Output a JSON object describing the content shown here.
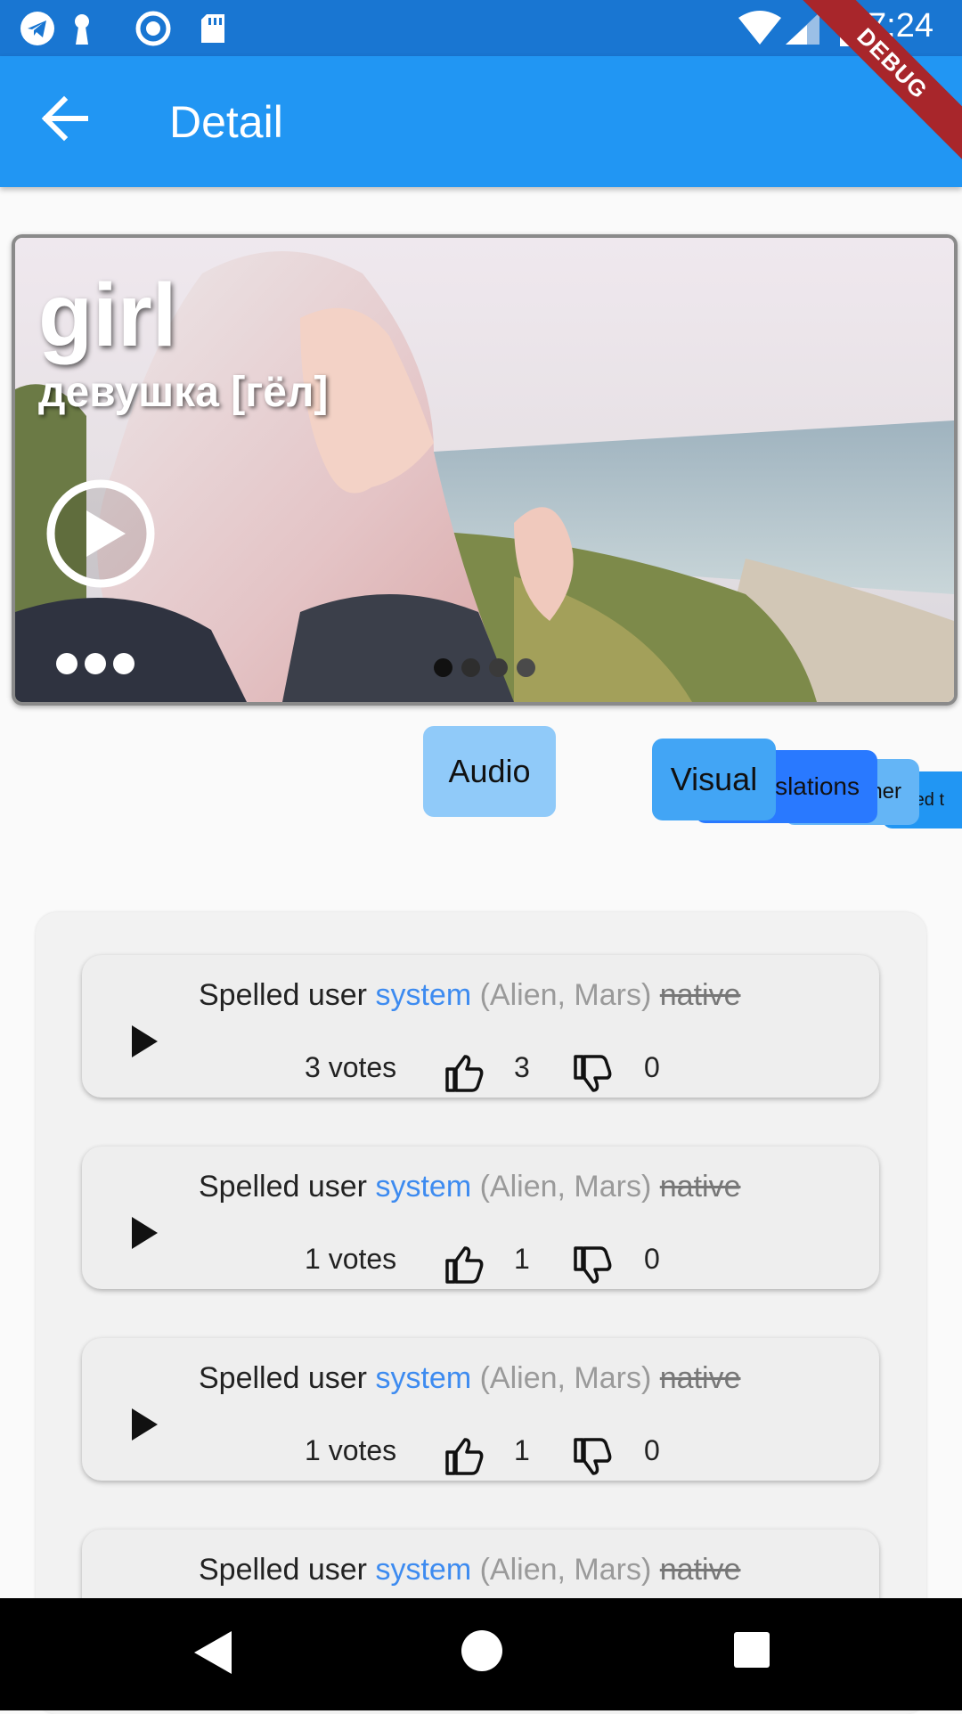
{
  "status_bar": {
    "time": "7:24",
    "debug_label": "DEBUG",
    "icons": [
      "telegram-icon",
      "keyhole-icon",
      "record-icon",
      "sd-card-icon",
      "wifi-icon",
      "signal-icon",
      "battery-icon"
    ],
    "background": "#1976d2"
  },
  "app_bar": {
    "title": "Detail",
    "background": "#2196f3"
  },
  "hero": {
    "word": "girl",
    "translation": "девушка [гёл]",
    "page_count": 4,
    "active_page": 1
  },
  "chips": {
    "audio": "Audio",
    "visual": "Visual",
    "translations_partial": "slations",
    "other_partial": "ner",
    "related_partial": "ated t"
  },
  "entries": [
    {
      "prefix": "Spelled user",
      "system": "system",
      "location": "(Alien, Mars)",
      "native": "native",
      "votes": "3 votes",
      "up": "3",
      "down": "0"
    },
    {
      "prefix": "Spelled user",
      "system": "system",
      "location": "(Alien, Mars)",
      "native": "native",
      "votes": "1 votes",
      "up": "1",
      "down": "0"
    },
    {
      "prefix": "Spelled user",
      "system": "system",
      "location": "(Alien, Mars)",
      "native": "native",
      "votes": "1 votes",
      "up": "1",
      "down": "0"
    },
    {
      "prefix": "Spelled user",
      "system": "system",
      "location": "(Alien, Mars)",
      "native": "native"
    }
  ],
  "colors": {
    "system_link": "#3d8bf0",
    "chip_audio": "#90caf9",
    "chip_visual": "#42a5f5",
    "chip_translations": "#2979ff"
  }
}
